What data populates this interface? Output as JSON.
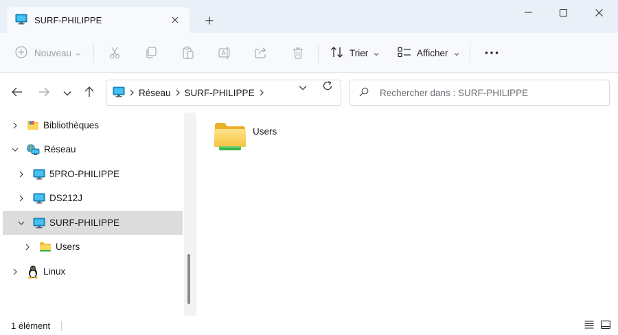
{
  "window": {
    "tab_title": "SURF-PHILIPPE",
    "new_tab_glyph": "+"
  },
  "toolbar": {
    "new_label": "Nouveau",
    "sort_label": "Trier",
    "view_label": "Afficher",
    "more_glyph": "•••",
    "icons": [
      "cut-icon",
      "copy-icon",
      "paste-icon",
      "rename-icon",
      "share-icon",
      "delete-icon"
    ]
  },
  "address": {
    "crumbs": [
      "Réseau",
      "SURF-PHILIPPE"
    ]
  },
  "search": {
    "placeholder": "Rechercher dans : SURF-PHILIPPE"
  },
  "sidebar": {
    "items": [
      {
        "label": "Bibliothèques",
        "icon": "library-folder-icon",
        "expanded": false
      },
      {
        "label": "Réseau",
        "icon": "network-icon",
        "expanded": true
      },
      {
        "label": "5PRO-PHILIPPE",
        "icon": "computer-icon",
        "expanded": false
      },
      {
        "label": "DS212J",
        "icon": "computer-icon",
        "expanded": false
      },
      {
        "label": "SURF-PHILIPPE",
        "icon": "computer-icon",
        "expanded": true,
        "selected": true
      },
      {
        "label": "Users",
        "icon": "shared-folder-icon",
        "expanded": false
      },
      {
        "label": "Linux",
        "icon": "linux-penguin-icon",
        "expanded": false
      }
    ]
  },
  "content": {
    "items": [
      {
        "label": "Users",
        "icon": "shared-folder-icon"
      }
    ]
  },
  "status": {
    "count_text": "1 élément"
  },
  "colors": {
    "titlebar_bg": "#eaf0f8",
    "toolbar_bg": "#f7f9fc",
    "selected_bg": "#dcdcdc",
    "folder_yellow": "#f6c343",
    "share_green": "#3bb54a",
    "monitor_blue": "#1a9bd7"
  }
}
